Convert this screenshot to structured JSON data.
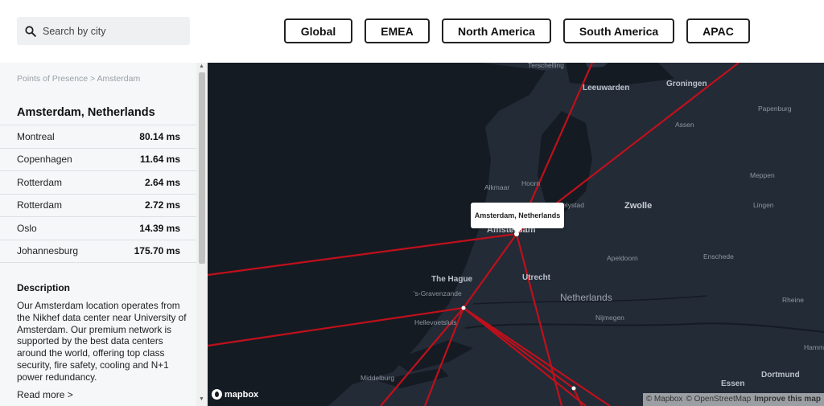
{
  "search": {
    "placeholder": "Search by city"
  },
  "regions": [
    "Global",
    "EMEA",
    "North America",
    "South America",
    "APAC"
  ],
  "sidebar": {
    "breadcrumb": "Points of Presence > Amsterdam",
    "title": "Amsterdam, Netherlands",
    "latencies": [
      {
        "city": "Montreal",
        "ms": "80.14 ms"
      },
      {
        "city": "Copenhagen",
        "ms": "11.64 ms"
      },
      {
        "city": "Rotterdam",
        "ms": "2.64 ms"
      },
      {
        "city": "Rotterdam",
        "ms": "2.72 ms"
      },
      {
        "city": "Oslo",
        "ms": "14.39 ms"
      },
      {
        "city": "Johannesburg",
        "ms": "175.70 ms"
      }
    ],
    "description_heading": "Description",
    "description": "Our Amsterdam location operates from the Nikhef data center near University of Amsterdam. Our premium network is supported by the best data centers around the world, offering top class security, fire safety, cooling and N+1 power redundancy.",
    "read_more": "Read more >"
  },
  "map": {
    "popup": "Amsterdam, Netherlands",
    "labels": {
      "leeuwarden": "Leeuwarden",
      "groningen": "Groningen",
      "assen": "Assen",
      "papenburg": "Papenburg",
      "alkmaar": "Alkmaar",
      "hoorn": "Hoorn",
      "lelystad": "elystad",
      "zwolle": "Zwolle",
      "meppen": "Meppen",
      "lingen": "Lingen",
      "amsterdam": "Amsterdam",
      "apeldoorn": "Apeldoorn",
      "enschede": "Enschede",
      "the_hague": "The Hague",
      "utrecht": "Utrecht",
      "gravenzande": "'s-Gravenzande",
      "hellevoetsluis": "Hellevoetsluis",
      "netherlands": "Netherlands",
      "nijmegen": "Nijmegen",
      "rheine": "Rheine",
      "middelburg": "Middelburg",
      "essen": "Essen",
      "dortmund": "Dortmund",
      "hamm": "Hamm",
      "terschelling": "Terschelling"
    },
    "logo": "mapbox",
    "attribution": {
      "mapbox": "© Mapbox",
      "osm": "© OpenStreetMap",
      "improve": "Improve this map"
    },
    "colors": {
      "route": "#c0101b",
      "land": "#232b37",
      "water": "#151b23"
    }
  }
}
